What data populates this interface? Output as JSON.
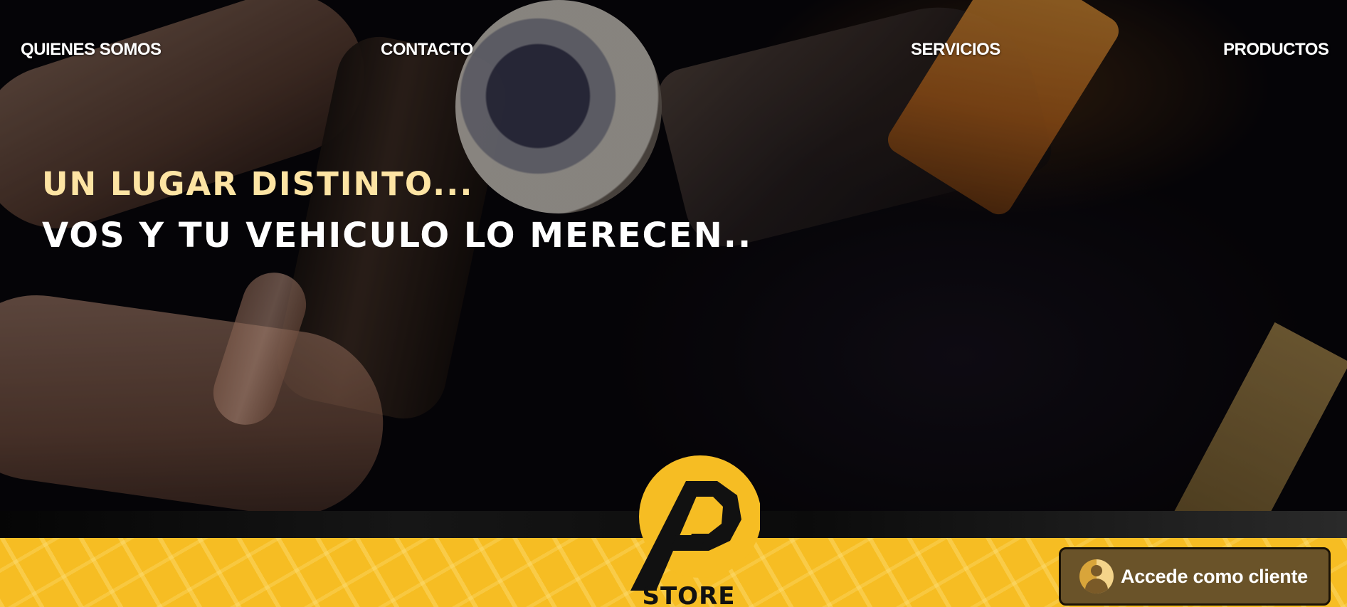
{
  "nav": {
    "items": [
      {
        "label": "QUIENES SOMOS"
      },
      {
        "label": "CONTACTO"
      },
      {
        "label": "SERVICIOS"
      },
      {
        "label": "PRODUCTOS"
      }
    ]
  },
  "hero": {
    "headline_1": "UN LUGAR DISTINTO...",
    "headline_2": "VOS Y TU VEHICULO LO MERECEN.."
  },
  "logo": {
    "text": "STORE"
  },
  "client_button": {
    "label": "Accede como cliente",
    "icon": "user-icon"
  },
  "colors": {
    "brand_yellow": "#f6bd23",
    "headline_accent": "#fde4a3",
    "button_bg": "#6a5329"
  }
}
